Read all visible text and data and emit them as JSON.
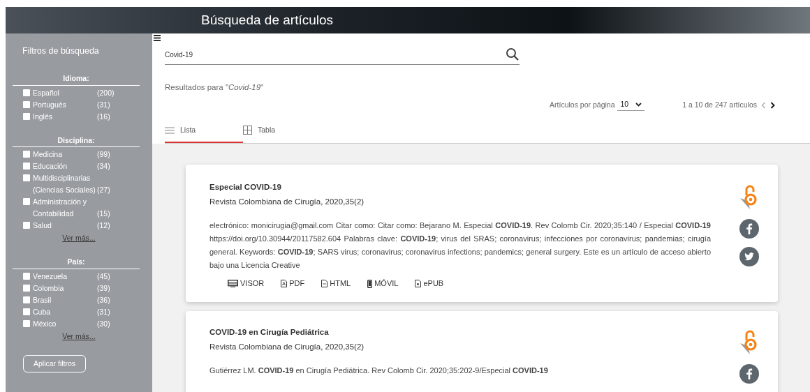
{
  "header": {
    "title": "Búsqueda de artículos"
  },
  "sidebar": {
    "title": "Filtros de búsqueda",
    "groups": [
      {
        "title": "Idioma:",
        "items": [
          {
            "label": "Español",
            "count": "(200)",
            "checked": false
          },
          {
            "label": "Portugués",
            "count": "(31)",
            "checked": false
          },
          {
            "label": "Inglés",
            "count": "(16)",
            "checked": false
          }
        ]
      },
      {
        "title": "Disciplina:",
        "items": [
          {
            "label": "Medicina",
            "count": "(99)",
            "checked": false
          },
          {
            "label": "Educación",
            "count": "(34)",
            "checked": false
          },
          {
            "label": "Multidisciplinarias (Ciencias Sociales)",
            "count": "(27)",
            "checked": false
          },
          {
            "label": "Administración y Contabilidad",
            "count": "(15)",
            "checked": false
          },
          {
            "label": "Salud",
            "count": "(12)",
            "checked": false
          }
        ],
        "more": "Ver más..."
      },
      {
        "title": "País:",
        "items": [
          {
            "label": "Venezuela",
            "count": "(45)",
            "checked": false
          },
          {
            "label": "Colombia",
            "count": "(39)",
            "checked": false
          },
          {
            "label": "Brasil",
            "count": "(36)",
            "checked": false
          },
          {
            "label": "Cuba",
            "count": "(31)",
            "checked": false
          },
          {
            "label": "México",
            "count": "(30)",
            "checked": false
          }
        ],
        "more": "Ver más..."
      }
    ],
    "apply": "Aplicar filtros"
  },
  "search": {
    "value": "Covid-19"
  },
  "results_label": "Resultados para \"*Covid-19*\"",
  "per_page": {
    "label": "Artículos por página",
    "value": "10"
  },
  "pagination": {
    "text": "1 a 10 de 247 artículos"
  },
  "tabs": [
    {
      "label": "Lista",
      "kind": "list",
      "selected": true
    },
    {
      "label": "Tabla",
      "kind": "table",
      "selected": false
    }
  ],
  "articles": [
    {
      "title": "Especial COVID-19",
      "journal": "Revista Colombiana de Cirugía, 2020,35(2)",
      "abstract": "electrónico: monicirugia@gmail.com Citar como: Citar como: Bejarano M. Especial **COVID-19**. Rev Colomb Cir. 2020;35:140 / Especial **COVID-19** https://doi.org/10.30944/20117582.604 Palabras clave: **COVID-19**; virus del SRAS; coronavirus; infecciones por coronavirus; pandemias; cirugía general. Keywords: **COVID-19**; SARS virus; coronavirus; coronavirus infections; pandemics; general surgery. Este es un artículo de acceso abierto bajo una Licencia Creative",
      "links": [
        {
          "label": "VISOR",
          "kind": "visor"
        },
        {
          "label": "PDF",
          "kind": "pdf"
        },
        {
          "label": "HTML",
          "kind": "html"
        },
        {
          "label": "MÓVIL",
          "kind": "movil"
        },
        {
          "label": "ePUB",
          "kind": "epub"
        }
      ]
    },
    {
      "title": "COVID-19 en Cirugía Pediátrica",
      "journal": "Revista Colombiana de Cirugía, 2020,35(2)",
      "abstract": "Gutiérrez LM. **COVID-19** en Cirugía Pediátrica. Rev Colomb Cir. 2020;35:202-9/Especial **COVID-19**"
    }
  ]
}
